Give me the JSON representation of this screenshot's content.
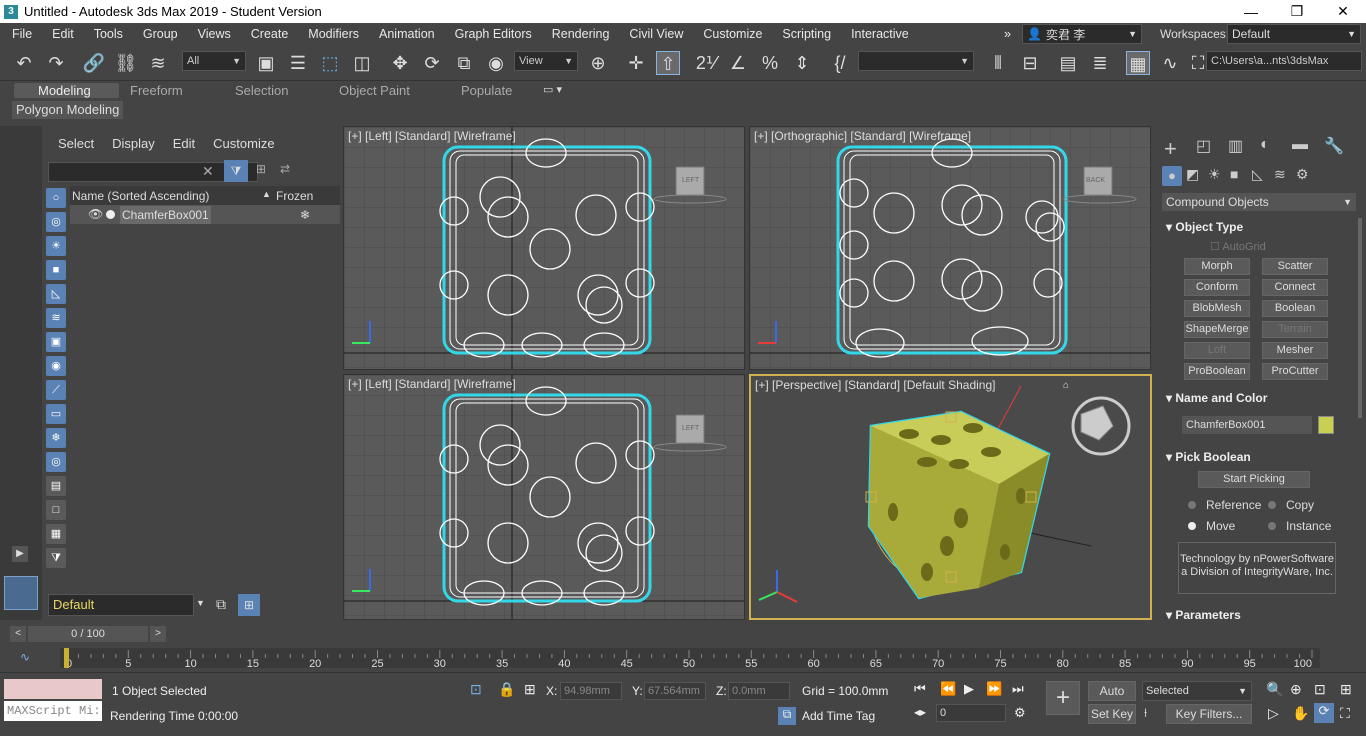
{
  "window": {
    "title": "Untitled - Autodesk 3ds Max 2019 - Student Version",
    "app_icon": "3",
    "minimize": "—",
    "maximize": "❐",
    "close": "✕"
  },
  "menu": {
    "items": [
      "File",
      "Edit",
      "Tools",
      "Group",
      "Views",
      "Create",
      "Modifiers",
      "Animation",
      "Graph Editors",
      "Rendering",
      "Civil View",
      "Customize",
      "Scripting",
      "Interactive"
    ],
    "overflow": "»",
    "user": "奕君 李",
    "workspaces_label": "Workspaces:",
    "workspace": "Default"
  },
  "toolbar": {
    "selection_filter": "All",
    "ref_coord": "View",
    "named_sel": "",
    "project_path": "C:\\Users\\a...nts\\3dsMax"
  },
  "ribbon": {
    "tabs": [
      "Modeling",
      "Freeform",
      "Selection",
      "Object Paint",
      "Populate"
    ],
    "active_tab": "Modeling",
    "sub_label": "Polygon Modeling"
  },
  "scene_explorer": {
    "menus": [
      "Select",
      "Display",
      "Edit",
      "Customize"
    ],
    "col_name": "Name (Sorted Ascending)",
    "sort_arrow": "▲",
    "col_frozen": "Frozen",
    "rows": [
      {
        "name": "ChamferBox001",
        "frozen_icon": "❄"
      }
    ],
    "layer": "Default"
  },
  "viewports": {
    "top_left": "[+] [Left] [Standard] [Wireframe]",
    "top_right": "[+] [Orthographic] [Standard] [Wireframe]",
    "bottom_left": "[+] [Left] [Standard] [Wireframe]",
    "bottom_right": "[+] [Perspective] [Standard] [Default Shading]",
    "viewcube_left": "LEFT",
    "viewcube_back": "BACK"
  },
  "command_panel": {
    "category": "Compound Objects",
    "object_type_title": "Object Type",
    "autogrid": "AutoGrid",
    "buttons": [
      {
        "label": "Morph",
        "enabled": true
      },
      {
        "label": "Scatter",
        "enabled": true
      },
      {
        "label": "Conform",
        "enabled": true
      },
      {
        "label": "Connect",
        "enabled": true
      },
      {
        "label": "BlobMesh",
        "enabled": true
      },
      {
        "label": "Boolean",
        "enabled": true
      },
      {
        "label": "ShapeMerge",
        "enabled": true
      },
      {
        "label": "Terrain",
        "enabled": false
      },
      {
        "label": "Loft",
        "enabled": false
      },
      {
        "label": "Mesher",
        "enabled": true
      },
      {
        "label": "ProBoolean",
        "enabled": true
      },
      {
        "label": "ProCutter",
        "enabled": true
      }
    ],
    "name_color_title": "Name and Color",
    "object_name": "ChamferBox001",
    "object_color": "#c8d050",
    "pick_boolean_title": "Pick Boolean",
    "start_picking": "Start Picking",
    "radio": {
      "reference": "Reference",
      "copy": "Copy",
      "move": "Move",
      "instance": "Instance"
    },
    "credit": "Technology by nPowerSoftware a Division of IntegrityWare, Inc.",
    "parameters_title": "Parameters"
  },
  "timeline": {
    "frame_display": "0 / 100",
    "ticks": [
      "0",
      "5",
      "10",
      "15",
      "20",
      "25",
      "30",
      "35",
      "40",
      "45",
      "50",
      "55",
      "60",
      "65",
      "70",
      "75",
      "80",
      "85",
      "90",
      "95",
      "100"
    ]
  },
  "status": {
    "maxscript": "MAXScript Mi:",
    "selected": "1 Object Selected",
    "render_time": "Rendering Time  0:00:00",
    "x_label": "X:",
    "x_value": "94.98mm",
    "y_label": "Y:",
    "y_value": "67.564mm",
    "z_label": "Z:",
    "z_value": "0.0mm",
    "grid": "Grid = 100.0mm",
    "add_time_tag": "Add Time Tag",
    "auto_key": "Auto Key",
    "selected_dd": "Selected",
    "set_key": "Set Key",
    "key_filters": "Key Filters...",
    "frame_field": "0"
  }
}
